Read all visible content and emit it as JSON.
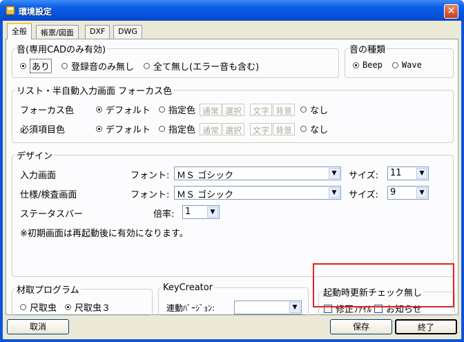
{
  "window": {
    "title": "環境設定",
    "close_glyph": "✕"
  },
  "tabs": [
    "全般",
    "帳票/図面",
    "DXF",
    "DWG"
  ],
  "sound": {
    "legend": "音(専用CADのみ有効)",
    "options": [
      "あり",
      "登録音のみ無し",
      "全て無し(エラー音も含む)"
    ],
    "selected": 0
  },
  "sound_type": {
    "legend": "音の種類",
    "options": [
      "Beep",
      "Wave"
    ],
    "selected": 0
  },
  "focus": {
    "legend": "リスト・半自動入力画面 フォーカス色",
    "rows": [
      {
        "label": "フォーカス色",
        "default": "デフォルト",
        "specified": "指定色",
        "none": "なし"
      },
      {
        "label": "必須項目色",
        "default": "デフォルト",
        "specified": "指定色",
        "none": "なし"
      }
    ],
    "color_buttons": [
      "通常",
      "選択",
      "文字",
      "背景"
    ]
  },
  "design": {
    "legend": "デザイン",
    "input_label": "入力画面",
    "spec_label": "仕様/検査画面",
    "status_label": "ステータスバー",
    "font_label": "フォント:",
    "size_label": "サイズ:",
    "zoom_label": "倍率:",
    "input_font": "ＭＳ ゴシック",
    "input_size": "11",
    "spec_font": "ＭＳ ゴシック",
    "spec_size": "9",
    "zoom": "1",
    "note": "※初期画面は再起動後に有効になります。"
  },
  "material": {
    "legend": "材取プログラム",
    "options": [
      "尺取虫",
      "尺取虫３"
    ],
    "selected": 1
  },
  "keycreator": {
    "legend": "KeyCreator",
    "label": "連動ﾊﾞｰｼﾞｮﾝ:",
    "value": ""
  },
  "update_check": {
    "legend": "起動時更新チェック無し",
    "options": [
      "修正ﾌｧｲﾙ",
      "お知らせ"
    ]
  },
  "buttons": {
    "cancel": "取消",
    "save": "保存",
    "finish": "終了"
  },
  "colors": {
    "titlebar": "#0a5ee8",
    "face": "#ece9d8",
    "highlight": "#e02020",
    "radio_dot": "#21a121"
  }
}
